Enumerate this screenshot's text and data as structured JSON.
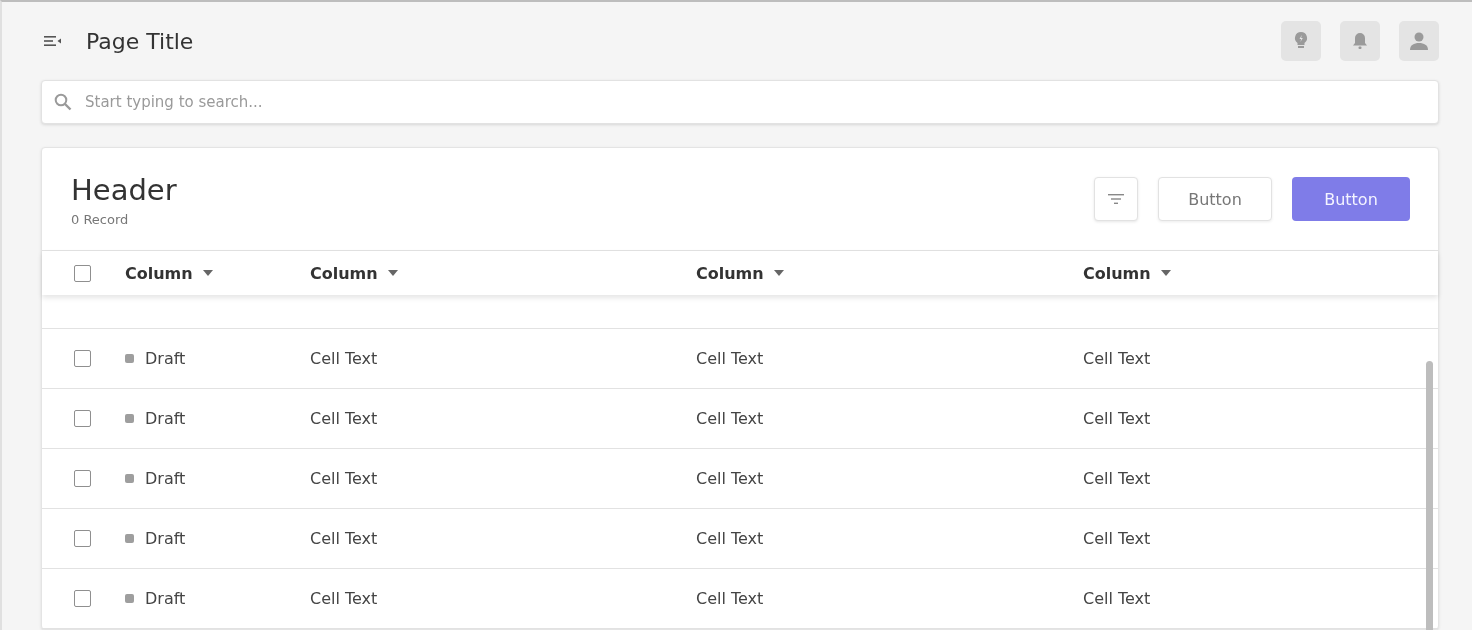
{
  "page_title": "Page Title",
  "search": {
    "placeholder": "Start typing to search..."
  },
  "card": {
    "header": "Header",
    "record_count": "0 Record",
    "buttons": [
      {
        "label": "Button",
        "kind": "secondary"
      },
      {
        "label": "Button",
        "kind": "primary"
      }
    ]
  },
  "table": {
    "select_all_checked": false,
    "columns": [
      {
        "label": "Column"
      },
      {
        "label": "Column"
      },
      {
        "label": "Column"
      },
      {
        "label": "Column"
      }
    ],
    "rows": [
      {
        "checked": false,
        "cells": [
          "Draft",
          "Cell Text",
          "Cell Text",
          "Cell Text"
        ]
      },
      {
        "checked": false,
        "cells": [
          "Draft",
          "Cell Text",
          "Cell Text",
          "Cell Text"
        ]
      },
      {
        "checked": false,
        "cells": [
          "Draft",
          "Cell Text",
          "Cell Text",
          "Cell Text"
        ]
      },
      {
        "checked": false,
        "cells": [
          "Draft",
          "Cell Text",
          "Cell Text",
          "Cell Text"
        ]
      },
      {
        "checked": false,
        "cells": [
          "Draft",
          "Cell Text",
          "Cell Text",
          "Cell Text"
        ]
      }
    ]
  }
}
